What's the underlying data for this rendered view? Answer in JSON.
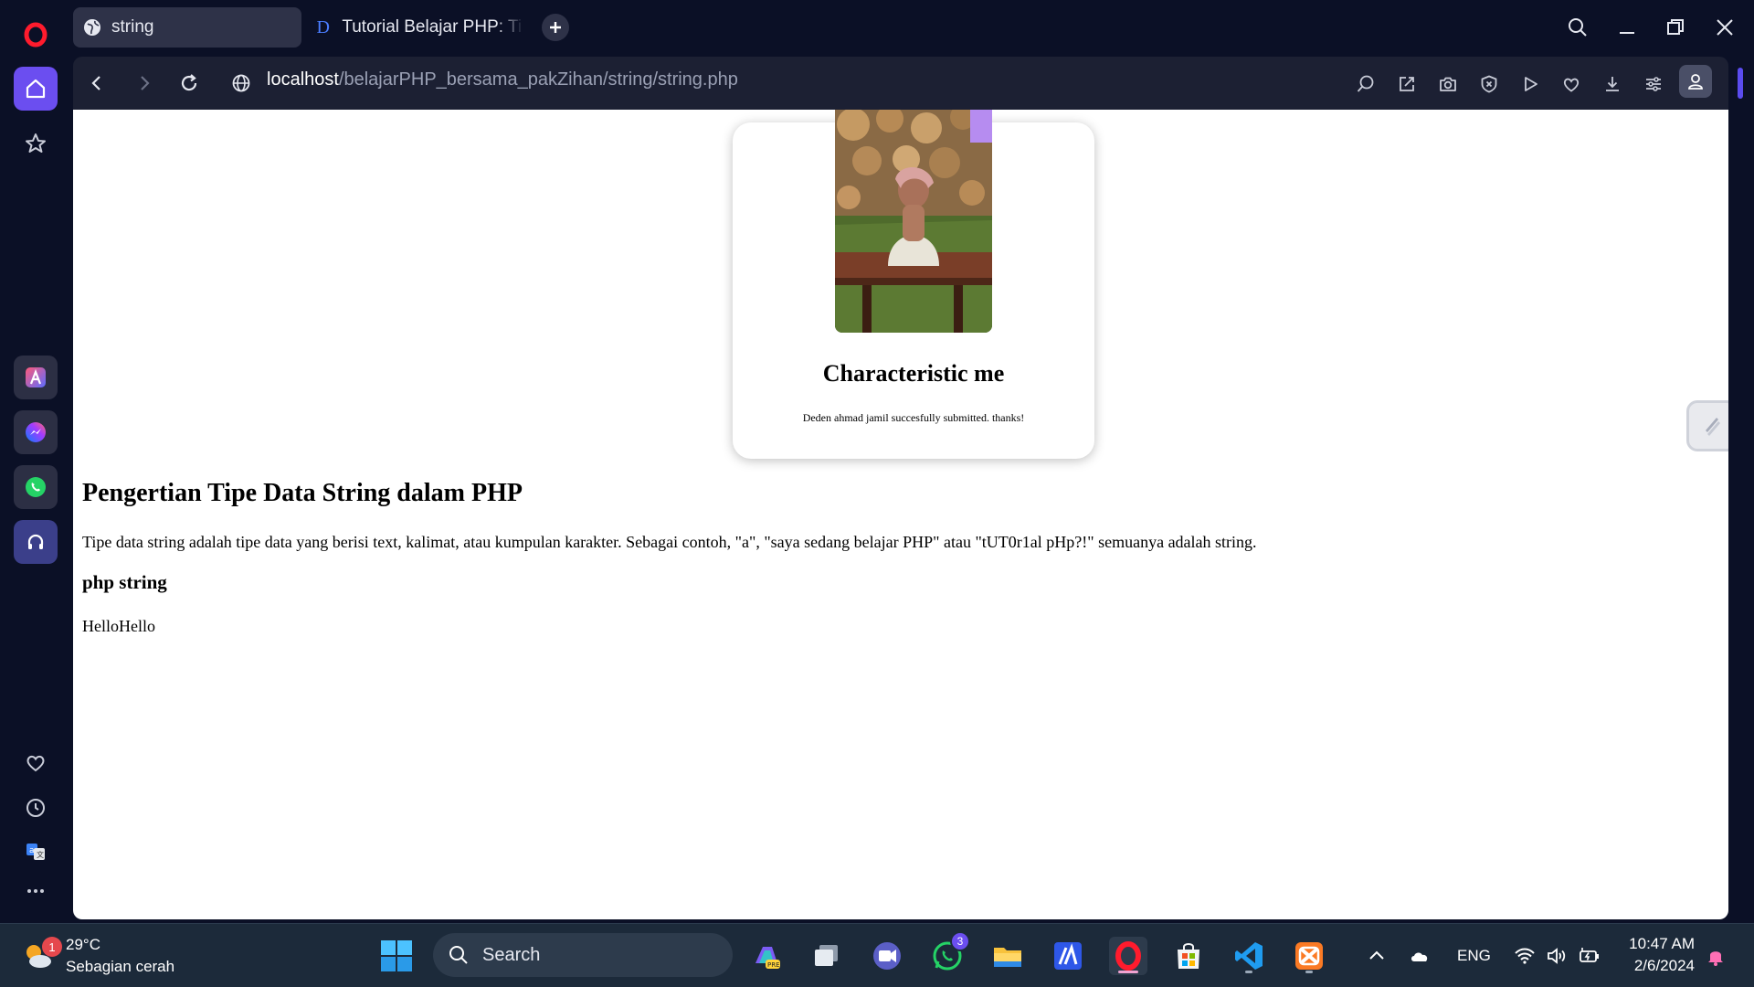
{
  "browser": {
    "tabs": [
      {
        "title": "string",
        "active": true,
        "icon": "globe-icon"
      },
      {
        "title": "Tutorial Belajar PHP: Tipe Data String dalam PHP",
        "active": false,
        "icon": "duniailkom-icon"
      }
    ],
    "url_host": "localhost",
    "url_path": "/belajarPHP_bersama_pakZihan/string/string.php",
    "accent_color": "#6b4ef0"
  },
  "page": {
    "card": {
      "title": "Characteristic me",
      "text": "Deden ahmad jamil succesfully submitted. thanks!"
    },
    "heading": "Pengertian Tipe Data String dalam PHP",
    "paragraph": "Tipe data string adalah tipe data yang berisi text, kalimat, atau kumpulan karakter. Sebagai contoh, \"a\", \"saya sedang belajar PHP\" atau \"tUT0r1al pHp?!\" semuanya adalah string.",
    "subheading": "php string",
    "output": "HelloHello"
  },
  "taskbar": {
    "weather_temp": "29°C",
    "weather_desc": "Sebagian cerah",
    "weather_badge": "1",
    "search_label": "Search",
    "whatsapp_badge": "3",
    "language": "ENG",
    "time": "10:47 AM",
    "date": "2/6/2024"
  }
}
